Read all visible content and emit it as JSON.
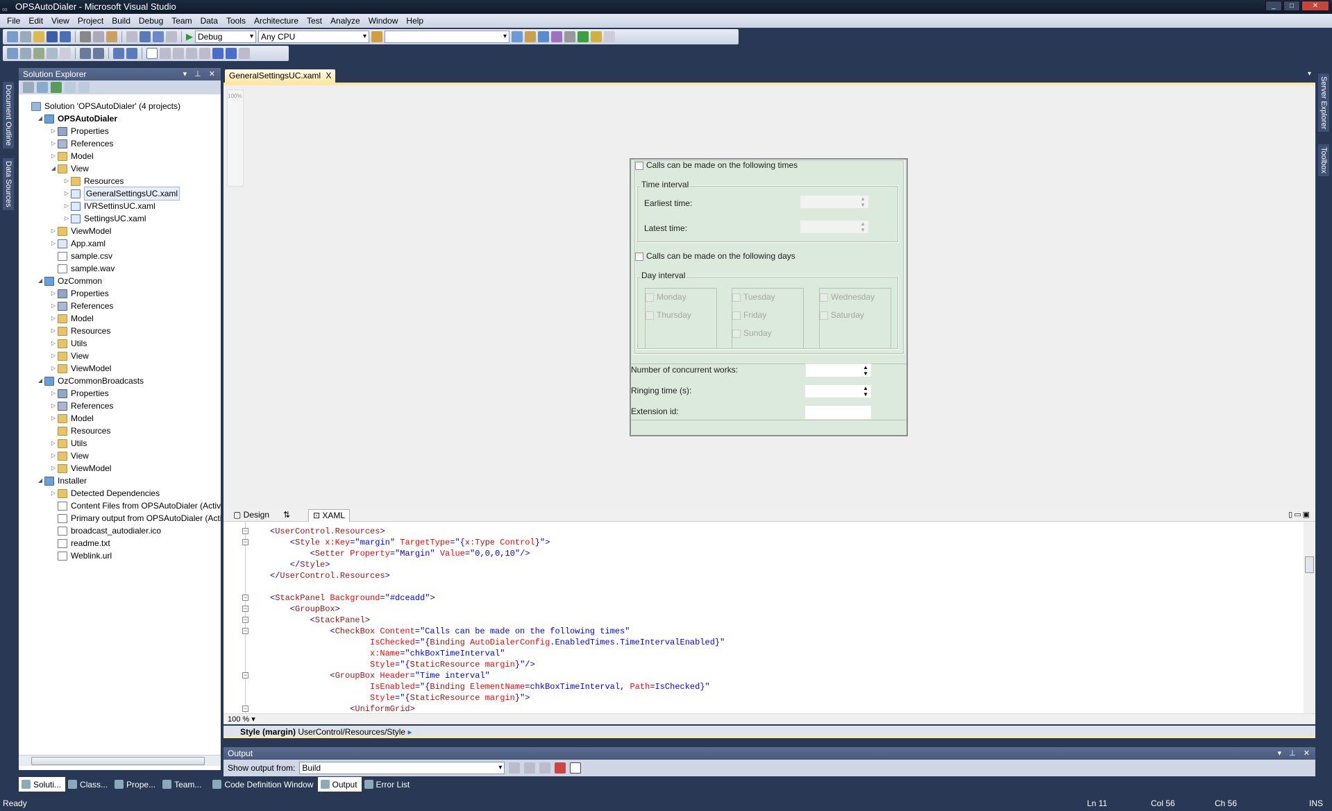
{
  "window": {
    "title": "OPSAutoDialer - Microsoft Visual Studio"
  },
  "menu": [
    "File",
    "Edit",
    "View",
    "Project",
    "Build",
    "Debug",
    "Team",
    "Data",
    "Tools",
    "Architecture",
    "Test",
    "Analyze",
    "Window",
    "Help"
  ],
  "toolbar": {
    "configuration": "Debug",
    "platform": "Any CPU",
    "find": ""
  },
  "side_tabs_left": [
    "Document Outline",
    "Data Sources"
  ],
  "side_tabs_right": [
    "Server Explorer",
    "Toolbox"
  ],
  "solution_explorer": {
    "title": "Solution Explorer",
    "items": [
      {
        "level": 0,
        "icon": "sol",
        "label": "Solution 'OPSAutoDialer' (4 projects)",
        "exp": ""
      },
      {
        "level": 1,
        "icon": "proj",
        "label": "OPSAutoDialer",
        "exp": "open",
        "bold": true
      },
      {
        "level": 2,
        "icon": "props",
        "label": "Properties",
        "exp": "closed"
      },
      {
        "level": 2,
        "icon": "refs",
        "label": "References",
        "exp": "closed"
      },
      {
        "level": 2,
        "icon": "folder",
        "label": "Model",
        "exp": "closed"
      },
      {
        "level": 2,
        "icon": "folder",
        "label": "View",
        "exp": "open"
      },
      {
        "level": 3,
        "icon": "folder",
        "label": "Resources",
        "exp": "closed"
      },
      {
        "level": 3,
        "icon": "xaml",
        "label": "GeneralSettingsUC.xaml",
        "exp": "closed",
        "selected": true
      },
      {
        "level": 3,
        "icon": "xaml",
        "label": "IVRSettinsUC.xaml",
        "exp": "closed"
      },
      {
        "level": 3,
        "icon": "xaml",
        "label": "SettingsUC.xaml",
        "exp": "closed"
      },
      {
        "level": 2,
        "icon": "folder",
        "label": "ViewModel",
        "exp": "closed"
      },
      {
        "level": 2,
        "icon": "xaml",
        "label": "App.xaml",
        "exp": "closed"
      },
      {
        "level": 2,
        "icon": "file",
        "label": "sample.csv",
        "exp": ""
      },
      {
        "level": 2,
        "icon": "file",
        "label": "sample.wav",
        "exp": ""
      },
      {
        "level": 1,
        "icon": "proj",
        "label": "OzCommon",
        "exp": "open"
      },
      {
        "level": 2,
        "icon": "props",
        "label": "Properties",
        "exp": "closed"
      },
      {
        "level": 2,
        "icon": "refs",
        "label": "References",
        "exp": "closed"
      },
      {
        "level": 2,
        "icon": "folder",
        "label": "Model",
        "exp": "closed"
      },
      {
        "level": 2,
        "icon": "folder",
        "label": "Resources",
        "exp": "closed"
      },
      {
        "level": 2,
        "icon": "folder",
        "label": "Utils",
        "exp": "closed"
      },
      {
        "level": 2,
        "icon": "folder",
        "label": "View",
        "exp": "closed"
      },
      {
        "level": 2,
        "icon": "folder",
        "label": "ViewModel",
        "exp": "closed"
      },
      {
        "level": 1,
        "icon": "proj",
        "label": "OzCommonBroadcasts",
        "exp": "open"
      },
      {
        "level": 2,
        "icon": "props",
        "label": "Properties",
        "exp": "closed"
      },
      {
        "level": 2,
        "icon": "refs",
        "label": "References",
        "exp": "closed"
      },
      {
        "level": 2,
        "icon": "folder",
        "label": "Model",
        "exp": "closed"
      },
      {
        "level": 2,
        "icon": "folder",
        "label": "Resources",
        "exp": ""
      },
      {
        "level": 2,
        "icon": "folder",
        "label": "Utils",
        "exp": "closed"
      },
      {
        "level": 2,
        "icon": "folder",
        "label": "View",
        "exp": "closed"
      },
      {
        "level": 2,
        "icon": "folder",
        "label": "ViewModel",
        "exp": "closed"
      },
      {
        "level": 1,
        "icon": "proj",
        "label": "Installer",
        "exp": "open"
      },
      {
        "level": 2,
        "icon": "folder",
        "label": "Detected Dependencies",
        "exp": "closed"
      },
      {
        "level": 2,
        "icon": "file",
        "label": "Content Files from OPSAutoDialer (Active)",
        "exp": ""
      },
      {
        "level": 2,
        "icon": "file",
        "label": "Primary output from OPSAutoDialer (Active)",
        "exp": ""
      },
      {
        "level": 2,
        "icon": "file",
        "label": "broadcast_autodialer.ico",
        "exp": ""
      },
      {
        "level": 2,
        "icon": "file",
        "label": "readme.txt",
        "exp": ""
      },
      {
        "level": 2,
        "icon": "file",
        "label": "Weblink.url",
        "exp": ""
      }
    ]
  },
  "document_tab": {
    "label": "GeneralSettingsUC.xaml",
    "close": "X"
  },
  "designer": {
    "zoom_label": "100%",
    "form": {
      "times_checkbox": "Calls can be made on the following times",
      "time_group": "Time interval",
      "earliest": "Earliest time:",
      "latest": "Latest time:",
      "days_checkbox": "Calls can be made on the following days",
      "day_group": "Day interval",
      "days": [
        [
          "Monday",
          "Thursday"
        ],
        [
          "Tuesday",
          "Friday",
          "Sunday"
        ],
        [
          "Wednesday",
          "Saturday"
        ]
      ],
      "concurrent": "Number of concurrent works:",
      "ringing": "Ringing time (s):",
      "extension": "Extension id:"
    }
  },
  "view_tabs": {
    "design": "Design",
    "swap": "⇅",
    "xaml": "XAML"
  },
  "code": {
    "fold_lines": [
      0,
      1,
      6,
      7,
      8,
      9,
      13,
      16
    ],
    "lines": [
      [
        [
          0,
          "<",
          "b"
        ],
        [
          0,
          "UserControl.Resources",
          "t"
        ],
        [
          0,
          ">",
          "b"
        ]
      ],
      [
        [
          1,
          "<",
          "b"
        ],
        [
          1,
          "Style",
          "t"
        ],
        [
          1,
          " x:Key",
          "a"
        ],
        [
          1,
          "=\"margin\"",
          "v"
        ],
        [
          1,
          " TargetType",
          "a"
        ],
        [
          1,
          "=\"{",
          "v"
        ],
        [
          1,
          "x:Type",
          "t"
        ],
        [
          1,
          " Control",
          "a"
        ],
        [
          1,
          "}\">",
          "v"
        ]
      ],
      [
        [
          2,
          "<",
          "b"
        ],
        [
          2,
          "Setter",
          "t"
        ],
        [
          2,
          " Property",
          "a"
        ],
        [
          2,
          "=\"Margin\"",
          "v"
        ],
        [
          2,
          " Value",
          "a"
        ],
        [
          2,
          "=\"0,0,0,10\"/>",
          "v"
        ]
      ],
      [
        [
          1,
          "</",
          "b"
        ],
        [
          1,
          "Style",
          "t"
        ],
        [
          1,
          ">",
          "b"
        ]
      ],
      [
        [
          0,
          "</",
          "b"
        ],
        [
          0,
          "UserControl.Resources",
          "t"
        ],
        [
          0,
          ">",
          "b"
        ]
      ],
      [],
      [
        [
          0,
          "<",
          "b"
        ],
        [
          0,
          "StackPanel",
          "t"
        ],
        [
          0,
          " Background",
          "a"
        ],
        [
          0,
          "=\"#dceadd\">",
          "v"
        ]
      ],
      [
        [
          1,
          "<",
          "b"
        ],
        [
          1,
          "GroupBox",
          "t"
        ],
        [
          1,
          ">",
          "b"
        ]
      ],
      [
        [
          2,
          "<",
          "b"
        ],
        [
          2,
          "StackPanel",
          "t"
        ],
        [
          2,
          ">",
          "b"
        ]
      ],
      [
        [
          3,
          "<",
          "b"
        ],
        [
          3,
          "CheckBox",
          "t"
        ],
        [
          3,
          " Content",
          "a"
        ],
        [
          3,
          "=\"Calls can be made on the following times\"",
          "v"
        ]
      ],
      [
        [
          5,
          "IsChecked",
          "a"
        ],
        [
          5,
          "=\"{",
          "v"
        ],
        [
          5,
          "Binding",
          "t"
        ],
        [
          5,
          " AutoDialerConfig",
          "a"
        ],
        [
          5,
          ".EnabledTimes.TimeIntervalEnabled}\"",
          "v"
        ]
      ],
      [
        [
          5,
          "x:Name",
          "a"
        ],
        [
          5,
          "=\"chkBoxTimeInterval\"",
          "v"
        ]
      ],
      [
        [
          5,
          "Style",
          "a"
        ],
        [
          5,
          "=\"{",
          "v"
        ],
        [
          5,
          "StaticResource",
          "t"
        ],
        [
          5,
          " margin",
          "a"
        ],
        [
          5,
          "}\"/>",
          "v"
        ]
      ],
      [
        [
          3,
          "<",
          "b"
        ],
        [
          3,
          "GroupBox",
          "t"
        ],
        [
          3,
          " Header",
          "a"
        ],
        [
          3,
          "=\"Time interval\"",
          "v"
        ]
      ],
      [
        [
          5,
          "IsEnabled",
          "a"
        ],
        [
          5,
          "=\"{",
          "v"
        ],
        [
          5,
          "Binding",
          "t"
        ],
        [
          5,
          " ElementName",
          "a"
        ],
        [
          5,
          "=chkBoxTimeInterval,",
          "v"
        ],
        [
          5,
          " Path",
          "a"
        ],
        [
          5,
          "=IsChecked}\"",
          "v"
        ]
      ],
      [
        [
          5,
          "Style",
          "a"
        ],
        [
          5,
          "=\"{",
          "v"
        ],
        [
          5,
          "StaticResource",
          "t"
        ],
        [
          5,
          " margin",
          "a"
        ],
        [
          5,
          "}\">",
          "v"
        ]
      ],
      [
        [
          4,
          "<",
          "b"
        ],
        [
          4,
          "UniformGrid",
          "t"
        ],
        [
          4,
          ">",
          "b"
        ]
      ]
    ]
  },
  "zoom": "100 %",
  "breadcrumb": {
    "bold": "Style (margin)",
    "path": "UserControl/Resources/Style"
  },
  "output": {
    "title": "Output",
    "show_from_label": "Show output from:",
    "source": "Build"
  },
  "bottom_tabs_left": [
    "Soluti...",
    "Class...",
    "Prope...",
    "Team..."
  ],
  "bottom_tabs_right": [
    "Code Definition Window",
    "Output",
    "Error List"
  ],
  "status": {
    "text": "Ready",
    "ln": "Ln 11",
    "col": "Col 56",
    "ch": "Ch 56",
    "mode": "INS"
  },
  "colors": {
    "form_background": "#dceadd",
    "chrome": "#293955",
    "active_tab": "#ffe8a6"
  }
}
